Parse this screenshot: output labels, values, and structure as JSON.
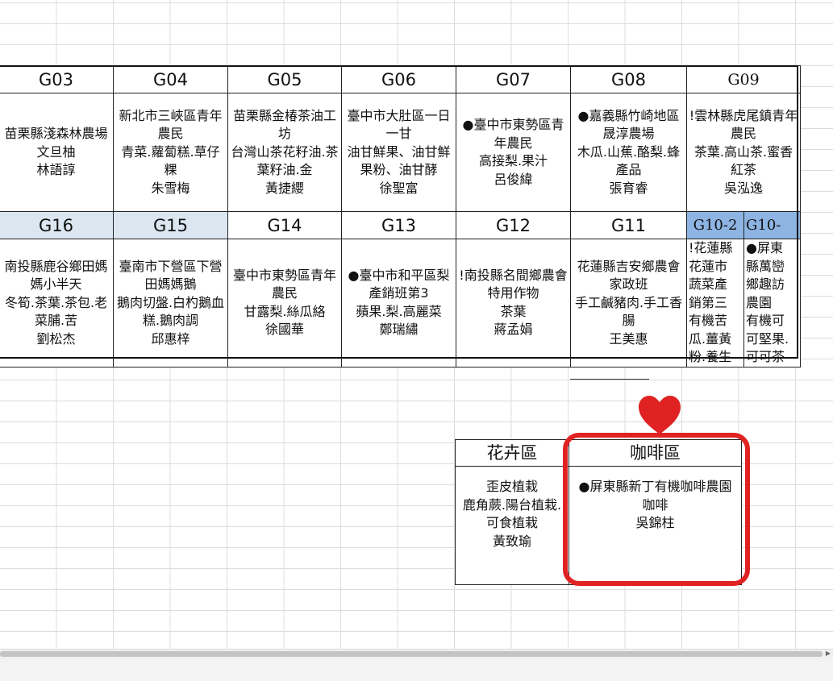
{
  "top_row": [
    {
      "code": "G03",
      "lines": [
        "苗栗縣淺森林農場",
        "文旦柚",
        "林語諄"
      ]
    },
    {
      "code": "G04",
      "lines": [
        "新北市三峽區青年農民",
        "青菜.蘿蔔糕.草仔粿",
        "朱雪梅"
      ]
    },
    {
      "code": "G05",
      "lines": [
        "苗栗縣金椿茶油工坊",
        "台灣山茶花籽油.茶葉籽油.金",
        "黃捷纓"
      ]
    },
    {
      "code": "G06",
      "lines": [
        "臺中市大肚區一日一甘",
        "油甘鮮果、油甘鮮果粉、油甘酵",
        "徐聖富"
      ]
    },
    {
      "code": "G07",
      "lines": [
        "●臺中市東勢區青年農民",
        "高接梨.果汁",
        "呂俊緯"
      ]
    },
    {
      "code": "G08",
      "lines": [
        "●嘉義縣竹崎地區 晟淳農場",
        "木瓜.山蕉.酪梨.蜂產品",
        "張育睿"
      ]
    },
    {
      "code": "G09",
      "lines": [
        "!雲林縣虎尾鎮青年農民",
        "茶葉.高山茶.蜜香紅茶",
        "吳泓逸"
      ]
    }
  ],
  "bottom_row": [
    {
      "code": "G16",
      "lines": [
        "南投縣鹿谷鄉田媽媽小半天",
        "冬筍.茶葉.茶包.老菜脯.苦",
        "劉松杰"
      ]
    },
    {
      "code": "G15",
      "lines": [
        "臺南市下營區下營田媽媽鵝",
        "鵝肉切盤.白杓鵝血糕.鵝肉調",
        "邱惠梓"
      ]
    },
    {
      "code": "G14",
      "lines": [
        "臺中市東勢區青年農民",
        "甘露梨.絲瓜絡",
        "徐國華"
      ]
    },
    {
      "code": "G13",
      "lines": [
        "●臺中市和平區梨產銷班第3",
        "蘋果.梨.高麗菜",
        "鄭瑞繡"
      ]
    },
    {
      "code": "G12",
      "lines": [
        "!南投縣名間鄉農會特用作物",
        "茶葉",
        "蔣孟娟"
      ]
    },
    {
      "code": "G11",
      "lines": [
        "花蓮縣吉安鄉農會家政班",
        "手工鹹豬肉.手工香腸",
        "王美惠"
      ]
    },
    {
      "code": "G10-2",
      "lines": [
        "!花蓮縣",
        "花蓮市",
        "蔬菜產",
        "銷第三",
        "有機苦",
        "瓜.薑黃",
        "粉.養生"
      ]
    },
    {
      "code": "G10-",
      "lines": [
        "●屏東",
        "縣萬巒",
        "鄉趣訪",
        "農園",
        "有機可",
        "可堅果.",
        "可可茶"
      ]
    }
  ],
  "flower": {
    "title": "花卉區",
    "lines": [
      "歪皮植栽",
      "鹿角蕨.陽台植栽.可食植栽",
      "黃致瑜"
    ]
  },
  "coffee": {
    "title": "咖啡區",
    "lines": [
      "●屏東縣新丁有機咖啡農園",
      "咖啡",
      "吳錦柱"
    ]
  },
  "colors": {
    "highlight": "#e02222",
    "header_blue": "#dce6f1",
    "header_blue_dark": "#8db4e2"
  },
  "icons": {
    "heart": "heart-icon"
  }
}
